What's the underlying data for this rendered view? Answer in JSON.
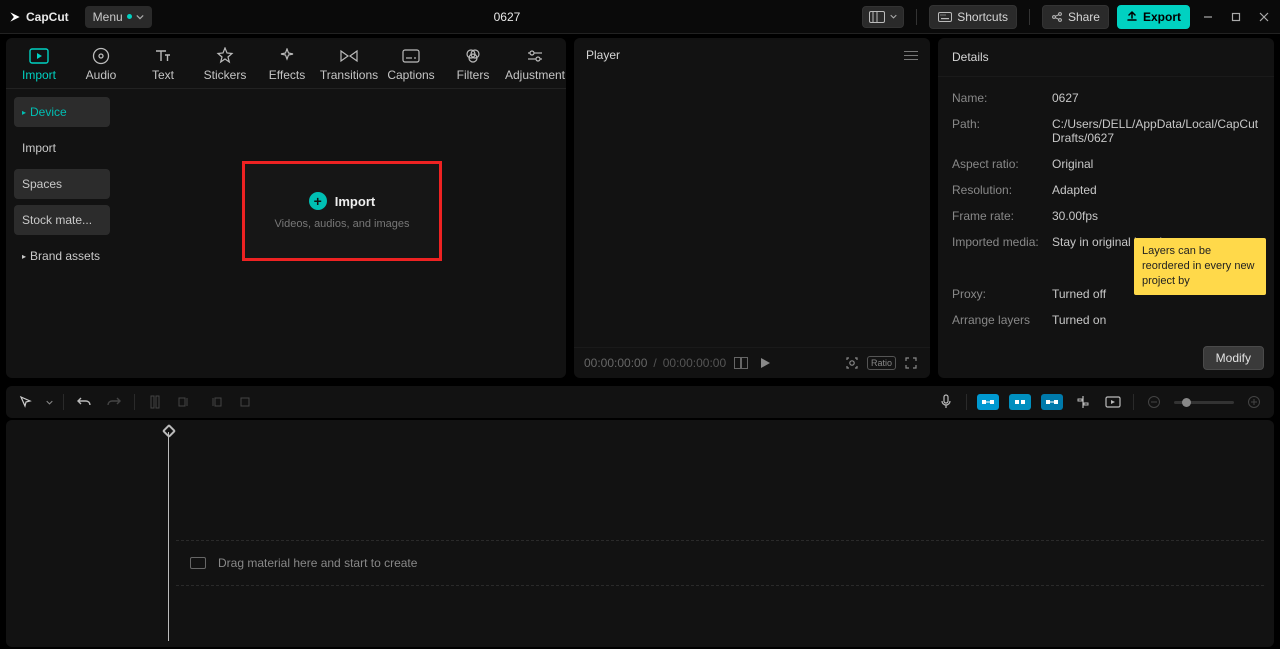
{
  "app": {
    "name": "CapCut",
    "menu_label": "Menu"
  },
  "project_title": "0627",
  "titlebar": {
    "shortcuts": "Shortcuts",
    "share": "Share",
    "export": "Export"
  },
  "top_tabs": [
    {
      "key": "import",
      "label": "Import"
    },
    {
      "key": "audio",
      "label": "Audio"
    },
    {
      "key": "text",
      "label": "Text"
    },
    {
      "key": "stickers",
      "label": "Stickers"
    },
    {
      "key": "effects",
      "label": "Effects"
    },
    {
      "key": "transitions",
      "label": "Transitions"
    },
    {
      "key": "captions",
      "label": "Captions"
    },
    {
      "key": "filters",
      "label": "Filters"
    },
    {
      "key": "adjustment",
      "label": "Adjustment"
    }
  ],
  "sidebar": {
    "items": [
      {
        "label": "Device"
      },
      {
        "label": "Import"
      },
      {
        "label": "Spaces"
      },
      {
        "label": "Stock mate..."
      },
      {
        "label": "Brand assets"
      }
    ]
  },
  "import_box": {
    "title": "Import",
    "subtitle": "Videos, audios, and images"
  },
  "player": {
    "title": "Player",
    "time_current": "00:00:00:00",
    "time_total": "00:00:00:00",
    "ratio_label": "Ratio"
  },
  "details": {
    "title": "Details",
    "rows": [
      {
        "k": "Name:",
        "v": "0627"
      },
      {
        "k": "Path:",
        "v": "C:/Users/DELL/AppData/Local/CapCut Drafts/0627"
      },
      {
        "k": "Aspect ratio:",
        "v": "Original"
      },
      {
        "k": "Resolution:",
        "v": "Adapted"
      },
      {
        "k": "Frame rate:",
        "v": "30.00fps"
      },
      {
        "k": "Imported media:",
        "v": "Stay in original location"
      },
      {
        "k": "Proxy:",
        "v": "Turned off"
      },
      {
        "k": "Arrange layers",
        "v": "Turned on"
      }
    ],
    "tooltip": "Layers can be reordered in every new project by",
    "modify": "Modify"
  },
  "timeline": {
    "drop_hint": "Drag material here and start to create"
  }
}
